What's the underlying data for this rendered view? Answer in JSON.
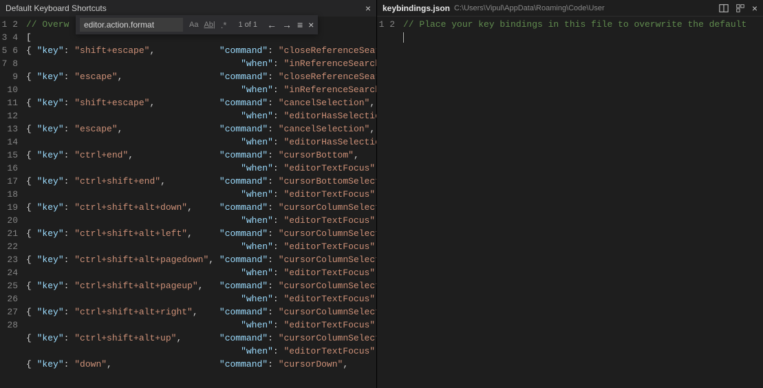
{
  "leftTab": {
    "title": "Default Keyboard Shortcuts"
  },
  "rightTab": {
    "title": "keybindings.json",
    "path": "C:\\Users\\Vipul\\AppData\\Roaming\\Code\\User"
  },
  "find": {
    "query": "editor.action.format",
    "count": "1 of 1",
    "optAa": "Aa",
    "optWord": "Ab|",
    "optRegex": ".*"
  },
  "leftLines": [
    {
      "n": 1,
      "t": "comment",
      "text": "// Overw"
    },
    {
      "n": 2,
      "t": "plain",
      "text": "["
    },
    {
      "n": 3,
      "t": "kv",
      "key": "shift+escape",
      "cmd": "closeReferenceSearch"
    },
    {
      "n": 4,
      "t": "wh",
      "when": "inReferenceSearchEd"
    },
    {
      "n": 5,
      "t": "kv",
      "key": "escape",
      "cmd": "closeReferenceSearch"
    },
    {
      "n": 6,
      "t": "wh",
      "when": "inReferenceSearchEd"
    },
    {
      "n": 7,
      "t": "kv",
      "key": "shift+escape",
      "cmd": "cancelSelection",
      "trail": ","
    },
    {
      "n": 8,
      "t": "wh",
      "when": "editorHasSelection"
    },
    {
      "n": 9,
      "t": "kv",
      "key": "escape",
      "cmd": "cancelSelection",
      "trail": ","
    },
    {
      "n": 10,
      "t": "wh",
      "when": "editorHasSelection "
    },
    {
      "n": 11,
      "t": "kv",
      "key": "ctrl+end",
      "cmd": "cursorBottom",
      "trail": ","
    },
    {
      "n": 12,
      "t": "whc",
      "when": "editorTextFocus"
    },
    {
      "n": 13,
      "t": "kv",
      "key": "ctrl+shift+end",
      "cmd": "cursorBottomSelect"
    },
    {
      "n": 14,
      "t": "whc",
      "when": "editorTextFocus"
    },
    {
      "n": 15,
      "t": "kv",
      "key": "ctrl+shift+alt+down",
      "cmd": "cursorColumnSelectD"
    },
    {
      "n": 16,
      "t": "whc",
      "when": "editorTextFocus"
    },
    {
      "n": 17,
      "t": "kv",
      "key": "ctrl+shift+alt+left",
      "cmd": "cursorColumnSelectL"
    },
    {
      "n": 18,
      "t": "whc",
      "when": "editorTextFocus"
    },
    {
      "n": 19,
      "t": "kv2",
      "key": "ctrl+shift+alt+pagedown",
      "cmd": "cursorColumnSelect"
    },
    {
      "n": 20,
      "t": "whc",
      "when": "editorTextFocus"
    },
    {
      "n": 21,
      "t": "kv2",
      "key": "ctrl+shift+alt+pageup",
      "cmd": "cursorColumnSelectP"
    },
    {
      "n": 22,
      "t": "whc",
      "when": "editorTextFocus"
    },
    {
      "n": 23,
      "t": "kv",
      "key": "ctrl+shift+alt+right",
      "cmd": "cursorColumnSelectR"
    },
    {
      "n": 24,
      "t": "whc",
      "when": "editorTextFocus"
    },
    {
      "n": 25,
      "t": "kv",
      "key": "ctrl+shift+alt+up",
      "cmd": "cursorColumnSelectU"
    },
    {
      "n": 26,
      "t": "whc",
      "when": "editorTextFocus"
    },
    {
      "n": 27,
      "t": "kv",
      "key": "down",
      "cmd": "cursorDown",
      "trail": ","
    },
    {
      "n": 28,
      "t": "blank"
    }
  ],
  "rightLines": [
    {
      "n": 1,
      "t": "comment",
      "text": "// Place your key bindings in this file to overwrite the default"
    },
    {
      "n": 2,
      "t": "cursor"
    }
  ],
  "labels": {
    "key": "key",
    "command": "command",
    "when": "when"
  }
}
